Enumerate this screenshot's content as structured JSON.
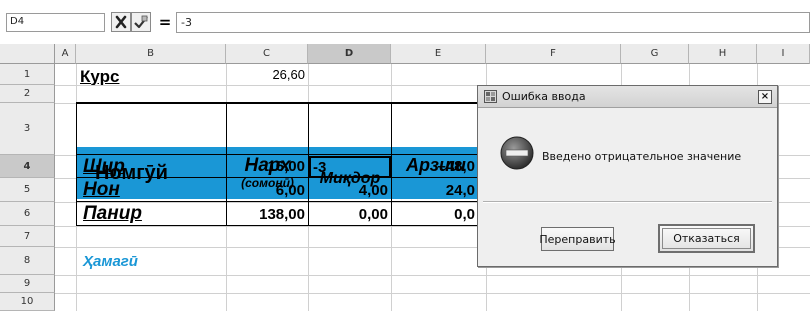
{
  "formula_bar": {
    "cell_reference": "D4",
    "cancel_icon": "x-icon",
    "accept_icon": "checkmark-icon",
    "function_symbol": "=",
    "content": "-3"
  },
  "sheet": {
    "columns": [
      "A",
      "B",
      "C",
      "D",
      "E",
      "F",
      "G",
      "H",
      "I"
    ],
    "active_column": "D",
    "rows": [
      "1",
      "2",
      "3",
      "4",
      "5",
      "6",
      "7",
      "8",
      "9",
      "10"
    ],
    "active_row": "4",
    "cells": {
      "rate_label": "Курс",
      "rate_value": "26,60",
      "header_name": "Номгӯй",
      "header_price": "Нарх",
      "header_price_unit": "(сомонӣ)",
      "header_qty": "Миқдор",
      "header_value": "Арзиш",
      "items": [
        {
          "name": "Шир",
          "price": "16,00",
          "qty": "-3",
          "value": "–48,0"
        },
        {
          "name": "Нон",
          "price": "6,00",
          "qty": "4,00",
          "value": "24,0"
        },
        {
          "name": "Панир",
          "price": "138,00",
          "qty": "0,00",
          "value": "0,0"
        }
      ],
      "total_label": "Ҳамагӣ"
    },
    "header_color": "#1a97d6",
    "total_color": "#1a97d6"
  },
  "dialog": {
    "title": "Ошибка ввода",
    "close_label": "×",
    "message": "Введено отрицательное значение",
    "icon": "error-stop-icon",
    "retry_button": "Переправить",
    "cancel_button": "Отказаться"
  }
}
